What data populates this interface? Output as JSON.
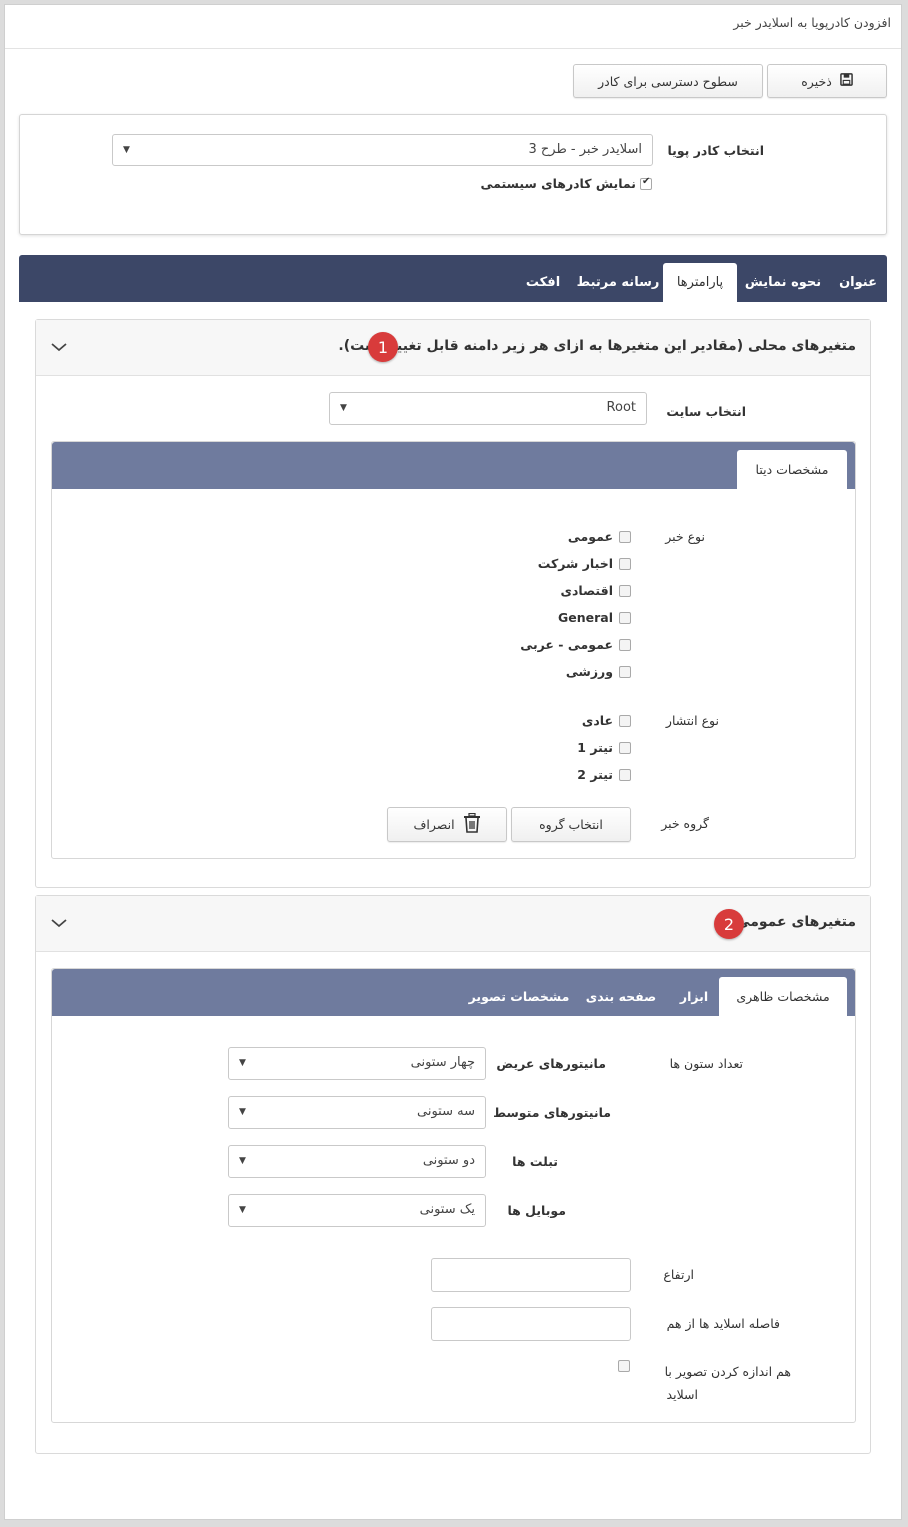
{
  "page_title": "افزودن کادرپویا به اسلایدر خبر",
  "toolbar": {
    "save_label": "ذخیره",
    "access_label": "سطوح دسترسی برای کادر"
  },
  "frame_select": {
    "label": "انتخاب کادر پویا",
    "value": "اسلایدر خبر - طرح 3",
    "show_system_label": "نمایش کادرهای سیستمی",
    "show_system_checked": true
  },
  "main_tabs": [
    {
      "label": "عنوان",
      "active": false
    },
    {
      "label": "نحوه نمایش",
      "active": false
    },
    {
      "label": "پارامترها",
      "active": true
    },
    {
      "label": "رسانه مرتبط",
      "active": false
    },
    {
      "label": "افکت",
      "active": false
    }
  ],
  "local_section": {
    "title": "متغیرهای محلی (مقادیر این متغیرها به ازای هر زیر دامنه قابل تغییر است).",
    "badge": "1",
    "site_label": "انتخاب سایت",
    "site_value": "Root",
    "subtab": "مشخصات دیتا",
    "news_type_label": "نوع خبر",
    "news_types": [
      "عمومی",
      "اخبار شرکت",
      "اقتصادی",
      "General",
      "عمومی - عربی",
      "ورزشی"
    ],
    "publish_type_label": "نوع انتشار",
    "publish_types": [
      "عادی",
      "تیتر 1",
      "تیتر 2"
    ],
    "news_group_label": "گروه خبر",
    "select_group_label": "انتخاب گروه",
    "cancel_label": "انصراف"
  },
  "general_section": {
    "title": "متغیرهای عمومی",
    "badge": "2",
    "subtabs": [
      {
        "label": "مشخصات ظاهری",
        "active": true
      },
      {
        "label": "ابزار",
        "active": false
      },
      {
        "label": "صفحه بندی",
        "active": false
      },
      {
        "label": "مشخصات تصویر",
        "active": false
      }
    ],
    "columns_label": "تعداد ستون ها",
    "wide_label": "مانیتورهای عریض",
    "wide_value": "چهار ستونی",
    "medium_label": "مانیتورهای متوسط",
    "medium_value": "سه ستونی",
    "tablet_label": "تبلت ها",
    "tablet_value": "دو ستونی",
    "mobile_label": "موبایل ها",
    "mobile_value": "یک ستونی",
    "height_label": "ارتفاع",
    "spacing_label": "فاصله اسلاید ها از هم",
    "resize_label_1": "هم اندازه کردن تصویر با",
    "resize_label_2": "اسلاید",
    "resize_checked": false
  },
  "colors": {
    "topbar": "#3c4767",
    "subbar": "#6f7b9e",
    "badge": "#d83b3b"
  }
}
